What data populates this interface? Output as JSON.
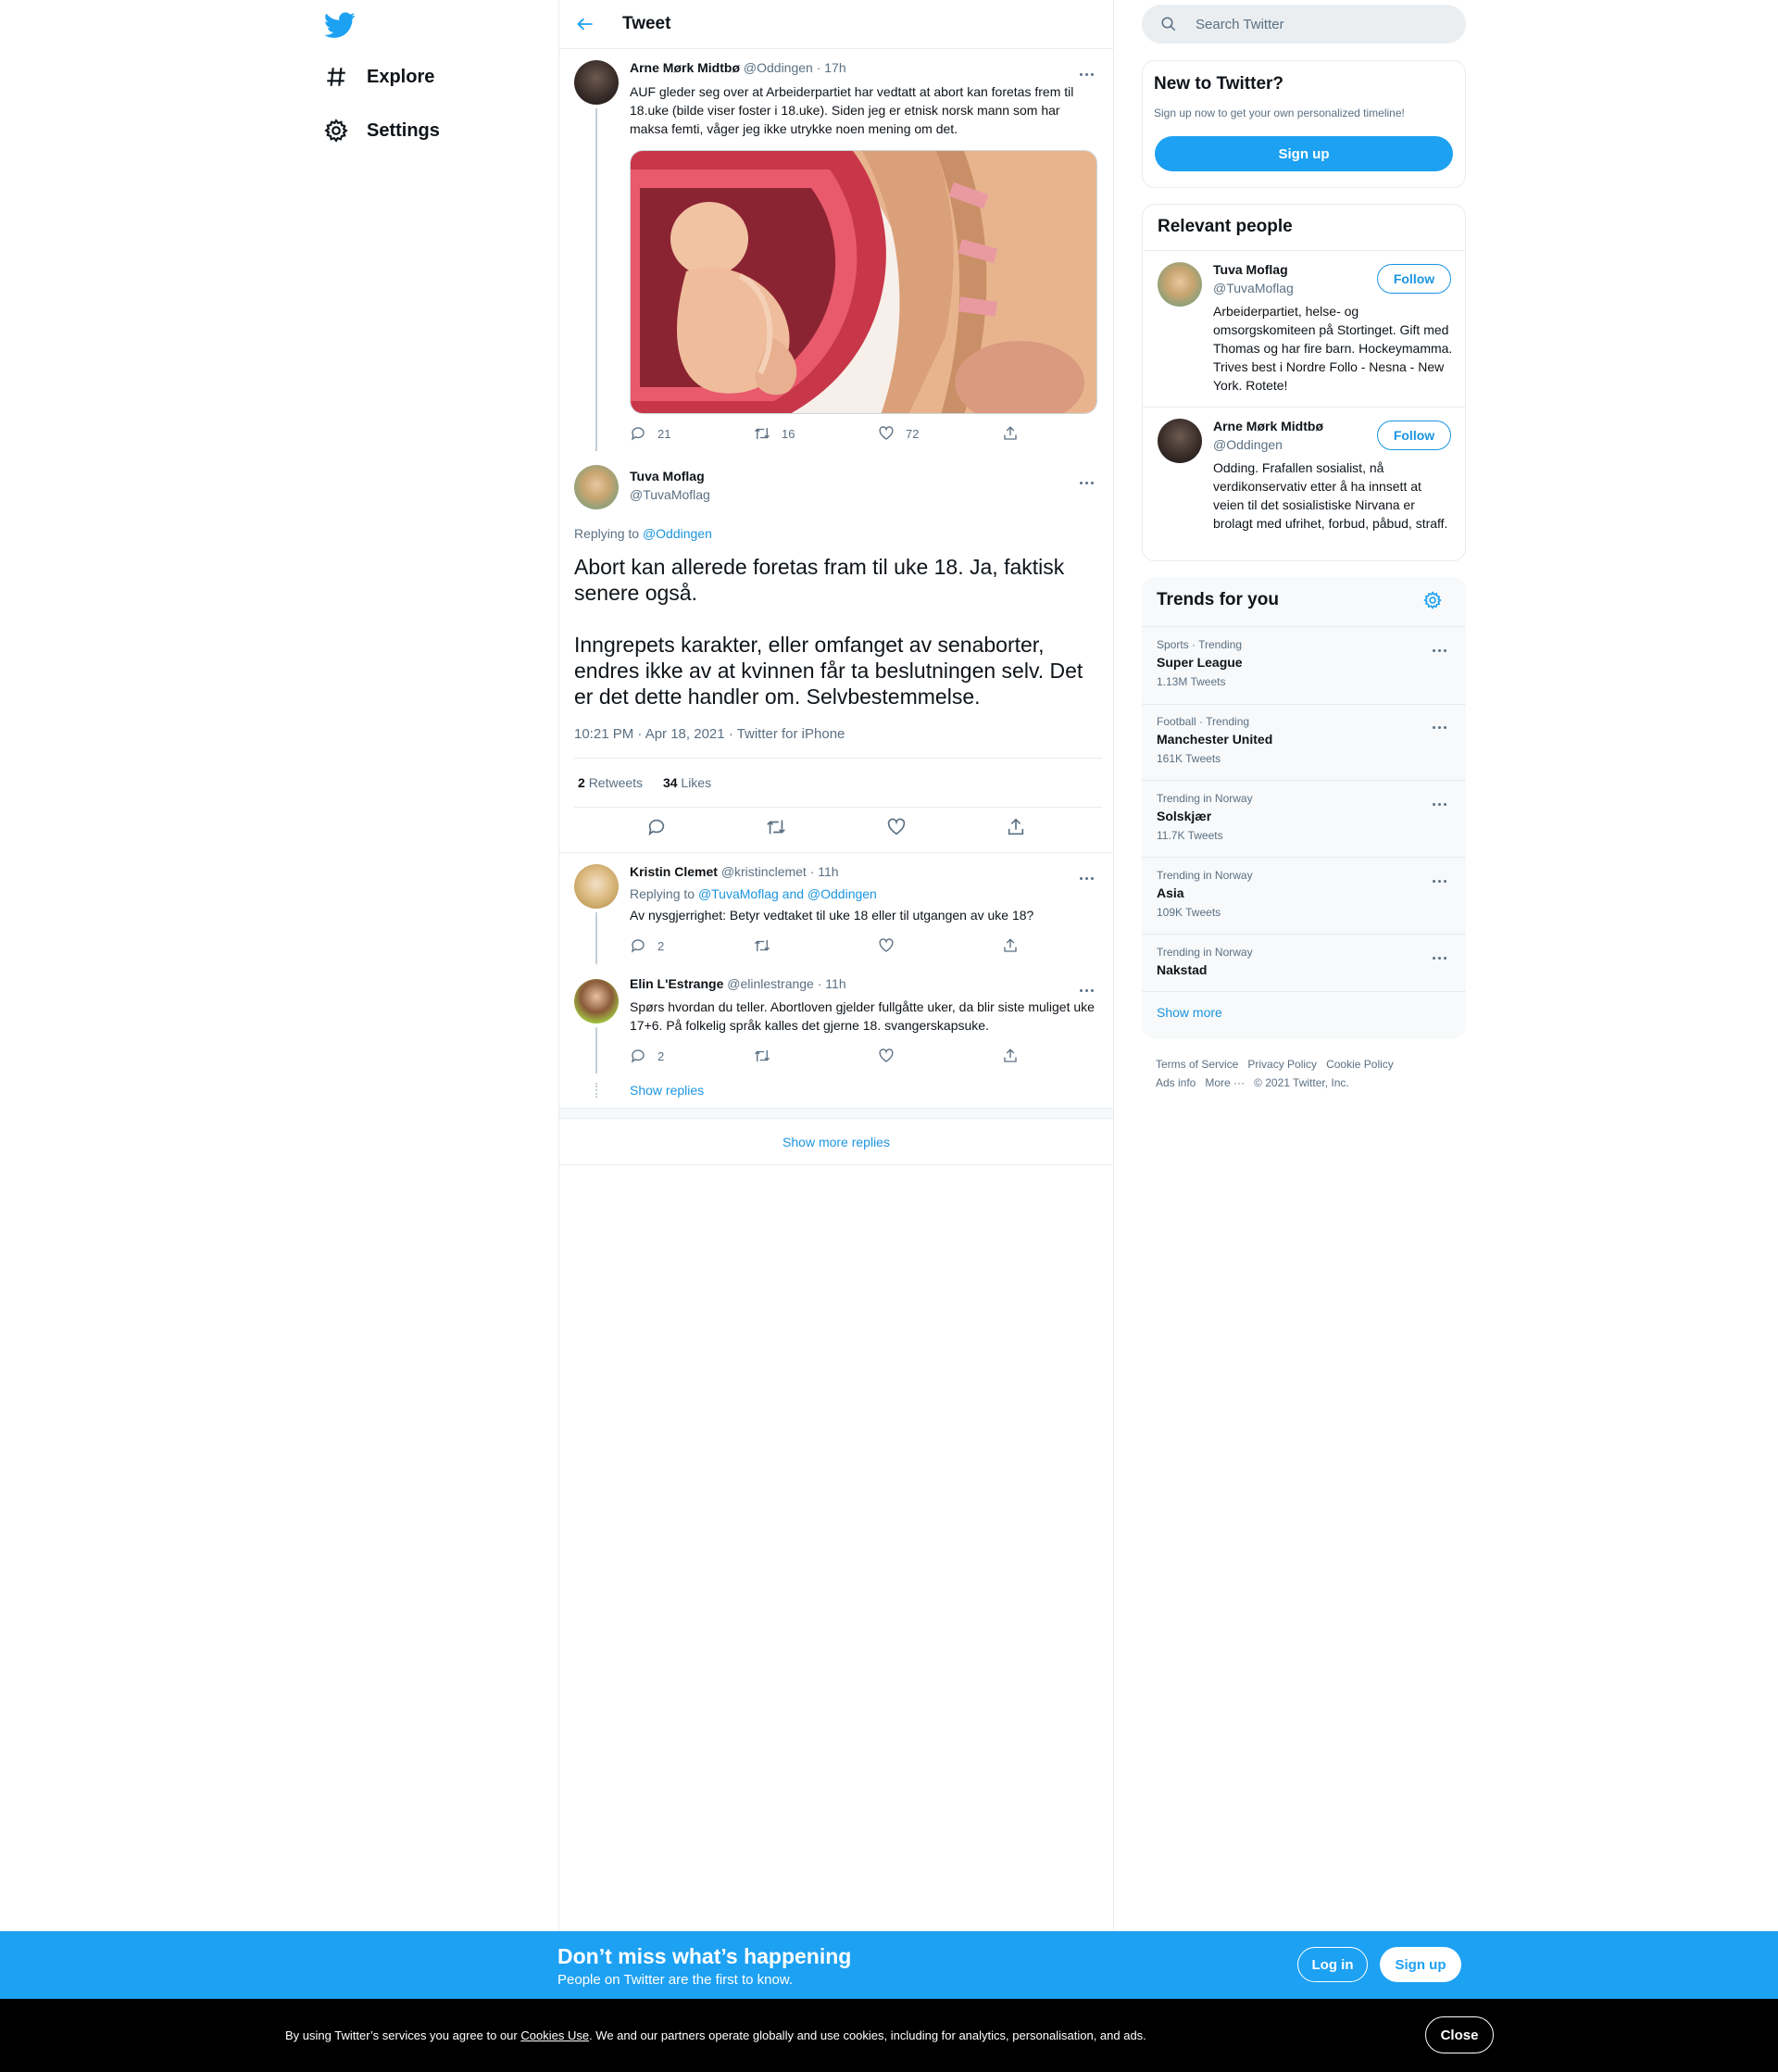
{
  "nav": {
    "explore": "Explore",
    "settings": "Settings"
  },
  "header": {
    "title": "Tweet"
  },
  "parent_tweet": {
    "name": "Arne Mørk Midtbø",
    "handle": "@Oddingen",
    "time": "· 17h",
    "text": "AUF gleder seg over at Arbeiderpartiet har vedtatt at abort kan foretas frem til 18.uke (bilde viser foster i 18.uke). Siden jeg er etnisk norsk mann som har maksa femti, våger jeg ikke utrykke noen mening om det.",
    "replies": "21",
    "retweets": "16",
    "likes": "72"
  },
  "main_tweet": {
    "name": "Tuva Moflag",
    "handle": "@TuvaMoflag",
    "replying_prefix": "Replying to",
    "replying_to": "@Oddingen",
    "text1": "Abort kan allerede foretas fram til uke 18. Ja, faktisk senere også.",
    "text2": "Inngrepets karakter, eller omfanget av senaborter, endres ikke av at kvinnen får ta beslutningen selv. Det er det dette handler om. Selvbestemmelse.",
    "meta": "10:21 PM · Apr 18, 2021 · Twitter for iPhone",
    "retweets_count": "2",
    "retweets_label": "Retweets",
    "likes_count": "34",
    "likes_label": "Likes"
  },
  "replies": [
    {
      "name": "Kristin Clemet",
      "handle": "@kristinclemet",
      "time": "· 11h",
      "replying_prefix": "Replying to",
      "replying_to": "@TuvaMoflag and @Oddingen",
      "text": "Av nysgjerrighet: Betyr vedtaket til uke 18 eller til utgangen av uke 18?",
      "replies": "2"
    },
    {
      "name": "Elin L'Estrange",
      "handle": "@elinlestrange",
      "time": "· 11h",
      "text": "Spørs hvordan du teller. Abortloven gjelder fullgåtte uker, da blir siste muliget uke 17+6. På folkelig språk kalles det gjerne 18. svangerskapsuke.",
      "replies": "2"
    }
  ],
  "show_replies": "Show replies",
  "show_more_replies": "Show more replies",
  "search": {
    "placeholder": "Search Twitter"
  },
  "new_to_twitter": {
    "title": "New to Twitter?",
    "subtitle": "Sign up now to get your own personalized timeline!",
    "signup": "Sign up"
  },
  "relevant": {
    "title": "Relevant people",
    "follow": "Follow",
    "people": [
      {
        "name": "Tuva Moflag",
        "handle": "@TuvaMoflag",
        "bio": "Arbeiderpartiet, helse- og omsorgskomiteen på Stortinget. Gift med Thomas og har fire barn. Hockeymamma. Trives best i Nordre Follo - Nesna - New York. Rotete!"
      },
      {
        "name": "Arne Mørk Midtbø",
        "handle": "@Oddingen",
        "bio": "Odding. Frafallen sosialist, nå verdikonservativ etter å ha innsett at veien til det sosialistiske Nirvana er brolagt med ufrihet, forbud, påbud, straff."
      }
    ]
  },
  "trends": {
    "title": "Trends for you",
    "items": [
      {
        "context": "Sports · Trending",
        "name": "Super League",
        "count": "1.13M Tweets"
      },
      {
        "context": "Football · Trending",
        "name": "Manchester United",
        "count": "161K Tweets"
      },
      {
        "context": "Trending in Norway",
        "name": "Solskjær",
        "count": "11.7K Tweets"
      },
      {
        "context": "Trending in Norway",
        "name": "Asia",
        "count": "109K Tweets"
      },
      {
        "context": "Trending in Norway",
        "name": "Nakstad",
        "count": ""
      }
    ],
    "show_more": "Show more"
  },
  "footer": {
    "terms": "Terms of Service",
    "privacy": "Privacy Policy",
    "cookie": "Cookie Policy",
    "ads": "Ads info",
    "more": "More ···",
    "copyright": "© 2021 Twitter, Inc."
  },
  "banner": {
    "title": "Don’t miss what’s happening",
    "subtitle": "People on Twitter are the first to know.",
    "login": "Log in",
    "signup": "Sign up"
  },
  "cookie_bar": {
    "prefix": "By using Twitter’s services you agree to our",
    "link": "Cookies Use",
    "suffix": ". We and our partners operate globally and use cookies, including for analytics, personalisation, and ads.",
    "close": "Close"
  },
  "colors": {
    "accent": "#1da1f2",
    "link": "#1b95e0",
    "muted": "#5b7083",
    "border": "#e6ecf0"
  }
}
